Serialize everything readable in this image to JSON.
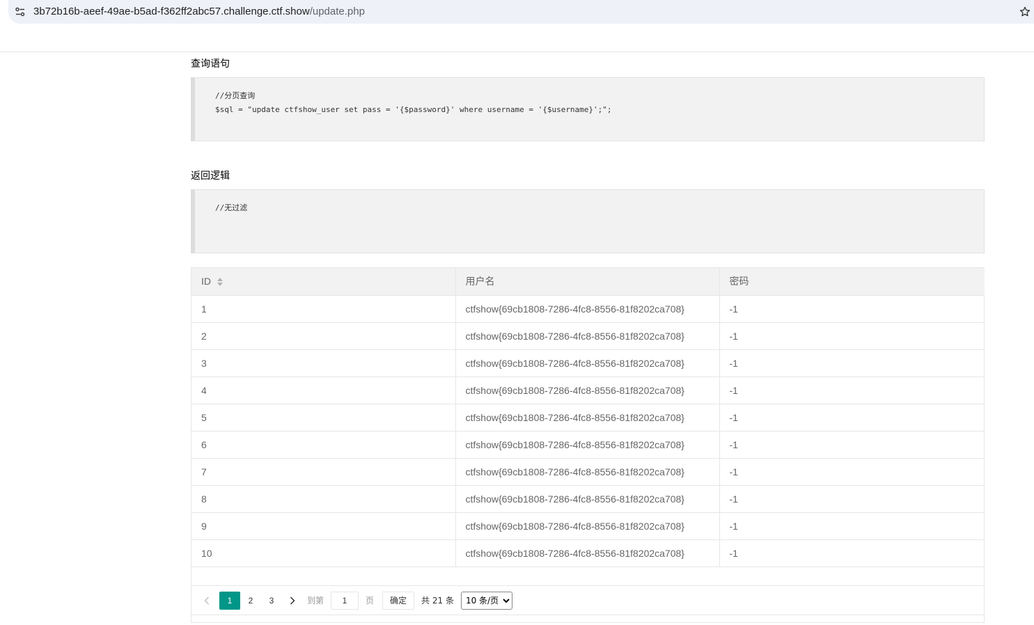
{
  "browser": {
    "url_host": "3b72b16b-aeef-49ae-b5ad-f362ff2abc57.challenge.ctf.show",
    "url_path": "/update.php"
  },
  "query_section": {
    "title": "查询语句",
    "lines": [
      "//分页查询",
      "$sql = \"update ctfshow_user set pass = '{$password}' where username = '{$username}';\";"
    ]
  },
  "return_section": {
    "title": "返回逻辑",
    "lines": [
      "//无过滤"
    ]
  },
  "table": {
    "columns": [
      "ID",
      "用户名",
      "密码"
    ],
    "rows": [
      [
        "1",
        "ctfshow{69cb1808-7286-4fc8-8556-81f8202ca708}",
        "-1"
      ],
      [
        "2",
        "ctfshow{69cb1808-7286-4fc8-8556-81f8202ca708}",
        "-1"
      ],
      [
        "3",
        "ctfshow{69cb1808-7286-4fc8-8556-81f8202ca708}",
        "-1"
      ],
      [
        "4",
        "ctfshow{69cb1808-7286-4fc8-8556-81f8202ca708}",
        "-1"
      ],
      [
        "5",
        "ctfshow{69cb1808-7286-4fc8-8556-81f8202ca708}",
        "-1"
      ],
      [
        "6",
        "ctfshow{69cb1808-7286-4fc8-8556-81f8202ca708}",
        "-1"
      ],
      [
        "7",
        "ctfshow{69cb1808-7286-4fc8-8556-81f8202ca708}",
        "-1"
      ],
      [
        "8",
        "ctfshow{69cb1808-7286-4fc8-8556-81f8202ca708}",
        "-1"
      ],
      [
        "9",
        "ctfshow{69cb1808-7286-4fc8-8556-81f8202ca708}",
        "-1"
      ],
      [
        "10",
        "ctfshow{69cb1808-7286-4fc8-8556-81f8202ca708}",
        "-1"
      ]
    ]
  },
  "pager": {
    "pages": [
      "1",
      "2",
      "3"
    ],
    "active_page": "1",
    "goto_label": "到第",
    "goto_value": "1",
    "page_unit": "页",
    "confirm_label": "确定",
    "total_label": "共 21 条",
    "page_size": "10 条/页",
    "active_color": "#009688"
  }
}
